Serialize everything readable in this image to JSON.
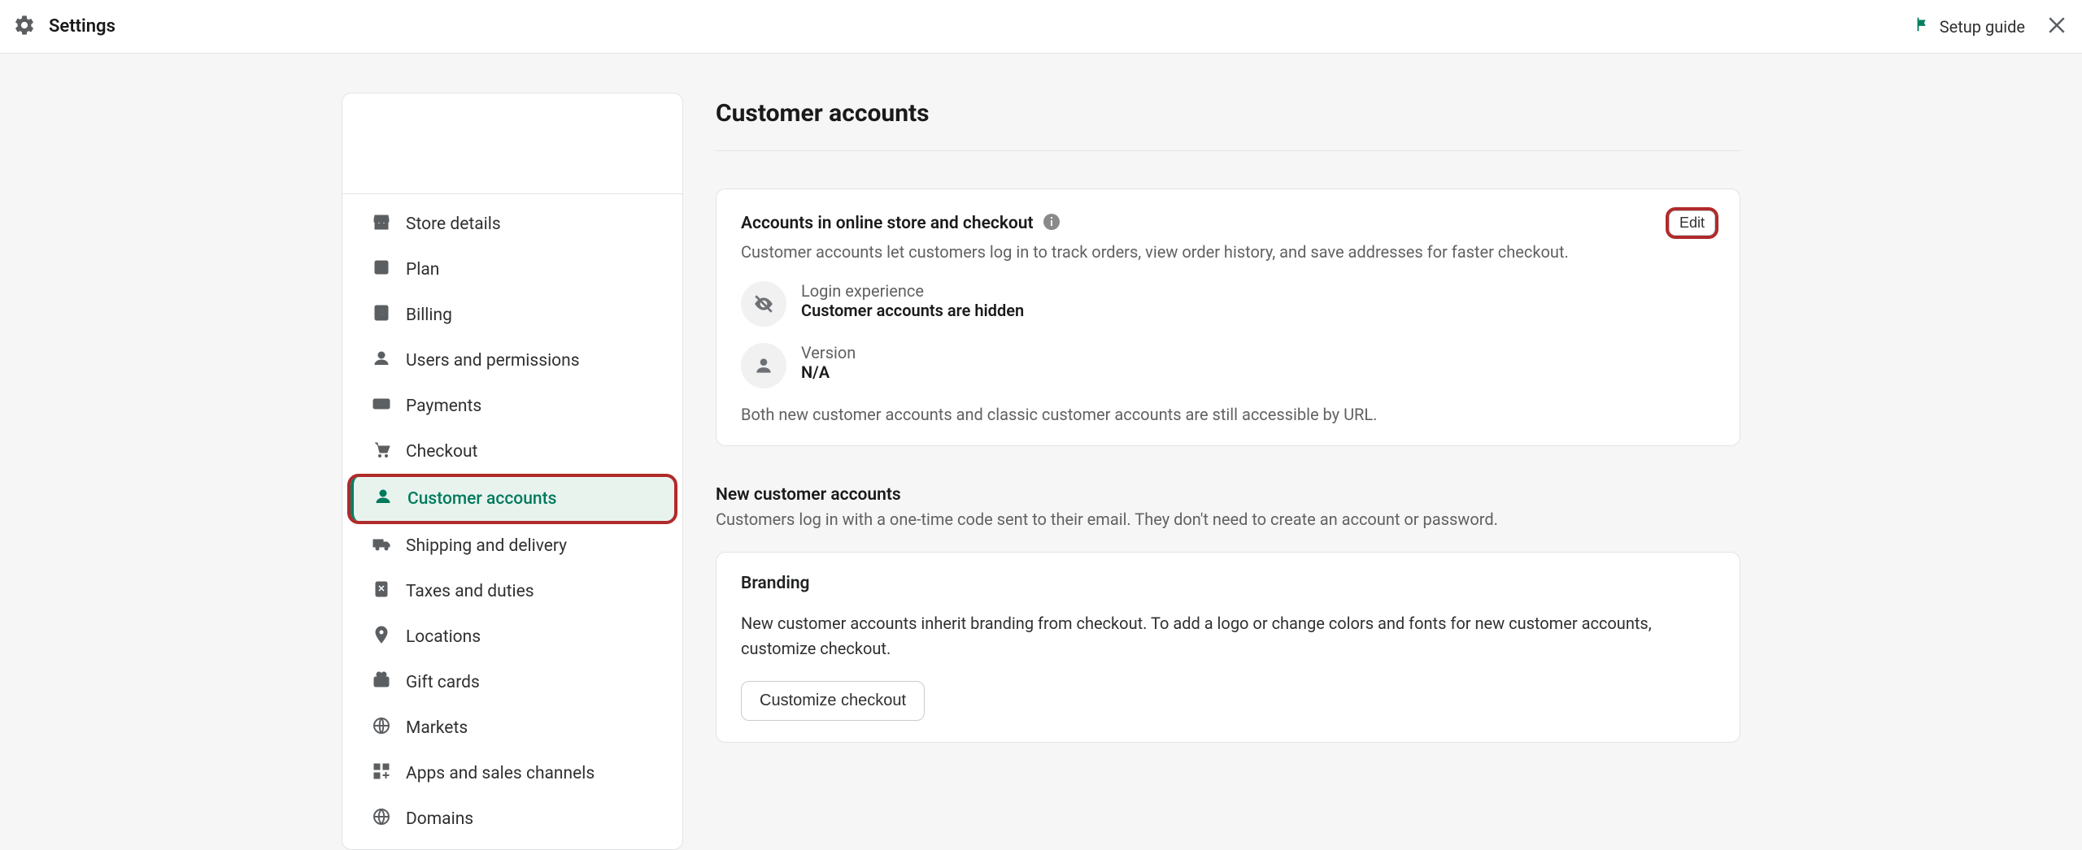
{
  "header": {
    "title": "Settings",
    "setup_guide": "Setup guide"
  },
  "sidebar": {
    "items": [
      {
        "label": "Store details",
        "icon": "store-icon"
      },
      {
        "label": "Plan",
        "icon": "plan-icon"
      },
      {
        "label": "Billing",
        "icon": "billing-icon"
      },
      {
        "label": "Users and permissions",
        "icon": "users-icon"
      },
      {
        "label": "Payments",
        "icon": "payments-icon"
      },
      {
        "label": "Checkout",
        "icon": "checkout-icon"
      },
      {
        "label": "Customer accounts",
        "icon": "customer-icon"
      },
      {
        "label": "Shipping and delivery",
        "icon": "shipping-icon"
      },
      {
        "label": "Taxes and duties",
        "icon": "taxes-icon"
      },
      {
        "label": "Locations",
        "icon": "locations-icon"
      },
      {
        "label": "Gift cards",
        "icon": "giftcard-icon"
      },
      {
        "label": "Markets",
        "icon": "markets-icon"
      },
      {
        "label": "Apps and sales channels",
        "icon": "apps-icon"
      },
      {
        "label": "Domains",
        "icon": "domains-icon"
      }
    ]
  },
  "main": {
    "title": "Customer accounts",
    "accounts_card": {
      "title": "Accounts in online store and checkout",
      "subtitle": "Customer accounts let customers log in to track orders, view order history, and save addresses for faster checkout.",
      "edit": "Edit",
      "login_experience_label": "Login experience",
      "login_experience_value": "Customer accounts are hidden",
      "version_label": "Version",
      "version_value": "N/A",
      "footnote": "Both new customer accounts and classic customer accounts are still accessible by URL."
    },
    "new_accounts": {
      "title": "New customer accounts",
      "subtitle": "Customers log in with a one-time code sent to their email. They don't need to create an account or password."
    },
    "branding_card": {
      "title": "Branding",
      "body": "New customer accounts inherit branding from checkout. To add a logo or change colors and fonts for new customer accounts, customize checkout.",
      "button": "Customize checkout"
    }
  }
}
